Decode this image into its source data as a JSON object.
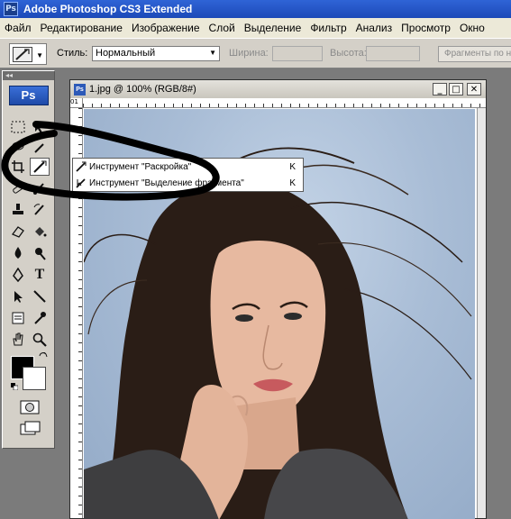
{
  "titlebar": {
    "logo": "Ps",
    "title": "Adobe Photoshop CS3 Extended"
  },
  "menu": [
    "Файл",
    "Редактирование",
    "Изображение",
    "Слой",
    "Выделение",
    "Фильтр",
    "Анализ",
    "Просмотр",
    "Окно"
  ],
  "options": {
    "style_label": "Стиль:",
    "style_value": "Нормальный",
    "width_label": "Ширина:",
    "height_label": "Высота:",
    "fragments_button": "Фрагменты по н"
  },
  "toolbox": {
    "logo": "Ps",
    "collapse": "◂◂",
    "text_tool_glyph": "T"
  },
  "document": {
    "title": "1.jpg @ 100% (RGB/8#)",
    "icon": "Ps",
    "ruler_corner": "01",
    "minimize": "_",
    "maximize": "□",
    "close": "✕"
  },
  "flyout": {
    "items": [
      {
        "label": "Инструмент \"Раскройка\"",
        "shortcut": "K",
        "icon": "slice-icon"
      },
      {
        "label": "Инструмент \"Выделение фрагмента\"",
        "shortcut": "K",
        "icon": "slice-select-icon"
      }
    ]
  },
  "colors": {
    "accent": "#2f64d6",
    "foreground": "#000000",
    "background": "#ffffff"
  }
}
